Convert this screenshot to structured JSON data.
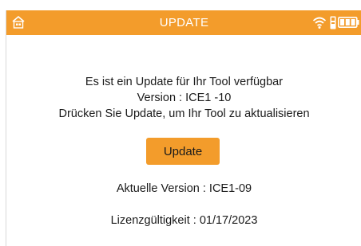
{
  "header": {
    "title": "UPDATE",
    "home_icon": "home-icon",
    "wifi_icon": "wifi-icon",
    "tool_icon": "tool-icon",
    "battery_icon": "battery-icon"
  },
  "message": {
    "line1": "Es ist ein Update für Ihr Tool verfügbar",
    "line2": "Version : ICE1 -10",
    "line3": "Drücken Sie Update, um Ihr Tool zu aktualisieren"
  },
  "update_button": {
    "label": "Update"
  },
  "info": {
    "current_version": "Aktuelle Version : ICE1-09",
    "license": "Lizenzgültigkeit : 01/17/2023"
  },
  "colors": {
    "accent": "#f39c2b",
    "text": "#1a1a1a"
  }
}
